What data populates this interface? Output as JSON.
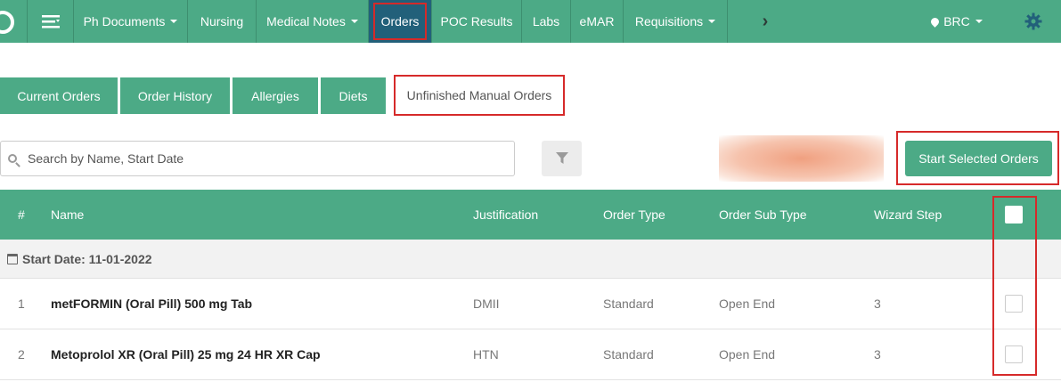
{
  "nav": {
    "items": [
      {
        "label": "Ph Documents",
        "has_caret": true
      },
      {
        "label": "Nursing",
        "has_caret": false
      },
      {
        "label": "Medical Notes",
        "has_caret": true
      },
      {
        "label": "Orders",
        "has_caret": false,
        "active": true
      },
      {
        "label": "POC Results",
        "has_caret": false
      },
      {
        "label": "Labs",
        "has_caret": false
      },
      {
        "label": "eMAR",
        "has_caret": false
      },
      {
        "label": "Requisitions",
        "has_caret": true
      }
    ],
    "location": "BRC",
    "icons": {
      "logo": "app-logo",
      "menu": "hamburger-icon",
      "more": "chevron-right-icon",
      "settings": "gear-icon",
      "location": "map-pin-icon"
    }
  },
  "tabs": [
    "Current Orders",
    "Order History",
    "Allergies",
    "Diets",
    "Unfinished Manual Orders"
  ],
  "search": {
    "placeholder": "Search by Name, Start Date",
    "value": ""
  },
  "actions": {
    "start_selected": "Start Selected Orders"
  },
  "table": {
    "columns": {
      "num": "#",
      "name": "Name",
      "justification": "Justification",
      "order_type": "Order Type",
      "order_sub_type": "Order Sub Type",
      "wizard_step": "Wizard Step"
    },
    "group_label": "Start Date: 11-01-2022",
    "rows": [
      {
        "num": "1",
        "name": "metFORMIN (Oral Pill) 500 mg Tab",
        "justification": "DMII",
        "order_type": "Standard",
        "order_sub_type": "Open End",
        "wizard_step": "3",
        "checked": false
      },
      {
        "num": "2",
        "name": "Metoprolol XR (Oral Pill) 25 mg 24 HR XR Cap",
        "justification": "HTN",
        "order_type": "Standard",
        "order_sub_type": "Open End",
        "wizard_step": "3",
        "checked": false
      }
    ]
  },
  "colors": {
    "primary": "#4caa86",
    "active_nav": "#22607a",
    "highlight": "#d62a2a"
  }
}
